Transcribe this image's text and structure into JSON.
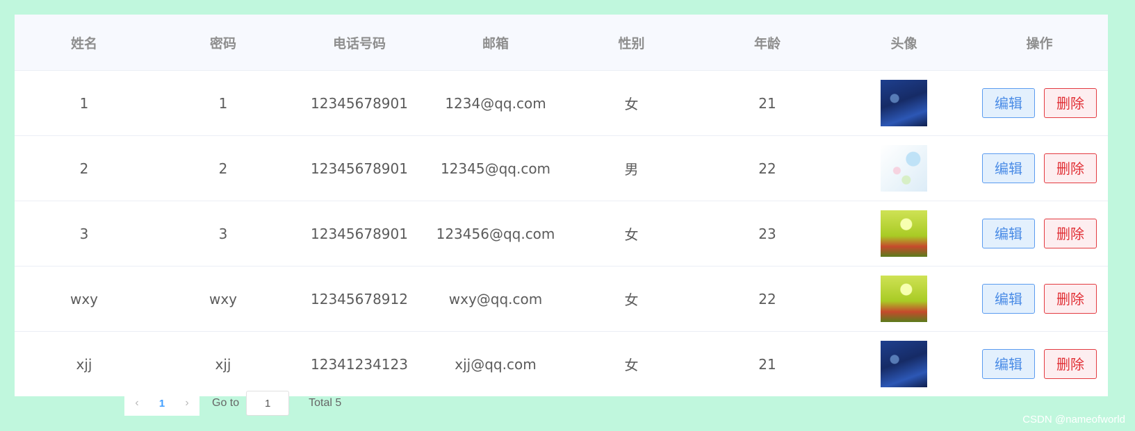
{
  "table": {
    "headers": [
      "姓名",
      "密码",
      "电话号码",
      "邮箱",
      "性别",
      "年龄",
      "头像",
      "操作"
    ],
    "rows": [
      {
        "name": "1",
        "password": "1",
        "phone": "12345678901",
        "email": "1234@qq.com",
        "gender": "女",
        "age": "21",
        "avatar": "avatar-blue"
      },
      {
        "name": "2",
        "password": "2",
        "phone": "12345678901",
        "email": "12345@qq.com",
        "gender": "男",
        "age": "22",
        "avatar": "avatar-floral"
      },
      {
        "name": "3",
        "password": "3",
        "phone": "12345678901",
        "email": "123456@qq.com",
        "gender": "女",
        "age": "23",
        "avatar": "avatar-tulip"
      },
      {
        "name": "wxy",
        "password": "wxy",
        "phone": "12345678912",
        "email": "wxy@qq.com",
        "gender": "女",
        "age": "22",
        "avatar": "avatar-tulip"
      },
      {
        "name": "xjj",
        "password": "xjj",
        "phone": "12341234123",
        "email": "xjj@qq.com",
        "gender": "女",
        "age": "21",
        "avatar": "avatar-blue"
      }
    ],
    "edit_label": "编辑",
    "delete_label": "删除"
  },
  "pagination": {
    "prev_icon": "chevron-left-icon",
    "next_icon": "chevron-right-icon",
    "current_page": "1",
    "goto_label": "Go to",
    "goto_value": "1",
    "total_label": "Total 5"
  },
  "watermark": "CSDN @nameofworld",
  "colors": {
    "background": "#c0f7dd",
    "header_bg": "#f7f9fe",
    "edit_border": "#5a9bf0",
    "delete_border": "#e33a40",
    "active_page": "#409eff"
  }
}
